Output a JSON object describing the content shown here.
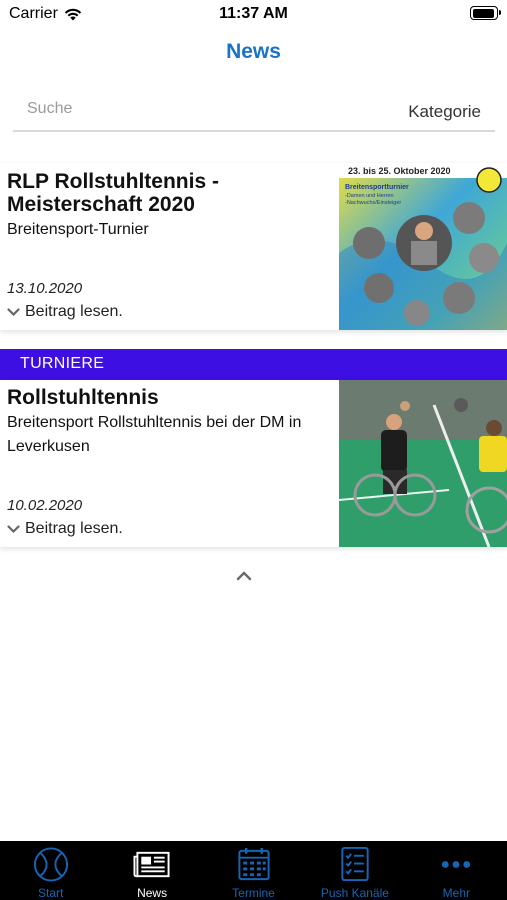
{
  "status_bar": {
    "carrier": "Carrier",
    "time": "11:37 AM",
    "battery_level": 0.95
  },
  "nav": {
    "title": "News"
  },
  "search": {
    "placeholder": "Suche",
    "category_label": "Kategorie"
  },
  "articles": [
    {
      "title": "RLP Rollstuhltennis - Meisterschaft 2020",
      "subtitle": "Breitensport-Turnier",
      "date": "13.10.2020",
      "more_label": "Beitrag lesen.",
      "image": {
        "date_text": "23. bis 25. Oktober 2020",
        "poster_title": "Breitensportturnier",
        "poster_line1": "-Damen und Herren",
        "poster_line2": "-Nachwuchs/Einsteiger"
      }
    },
    {
      "category": "TURNIERE",
      "title": "Rollstuhltennis",
      "subtitle": "Breitensport Rollstuhltennis bei der DM in Leverkusen",
      "date": "10.02.2020",
      "more_label": "Beitrag lesen."
    }
  ],
  "tab_bar": {
    "tabs": [
      {
        "label": "Start",
        "icon": "tennis-ball-icon",
        "active": false
      },
      {
        "label": "News",
        "icon": "newspaper-icon",
        "active": true
      },
      {
        "label": "Termine",
        "icon": "calendar-icon",
        "active": false
      },
      {
        "label": "Push Kanäle",
        "icon": "checklist-icon",
        "active": false
      },
      {
        "label": "Mehr",
        "icon": "more-dots-icon",
        "active": false
      }
    ]
  },
  "colors": {
    "accent": "#1a73c9",
    "tab_inactive": "#1766b5",
    "category_banner": "#3d0fe3",
    "tab_bar_bg": "#000000"
  }
}
